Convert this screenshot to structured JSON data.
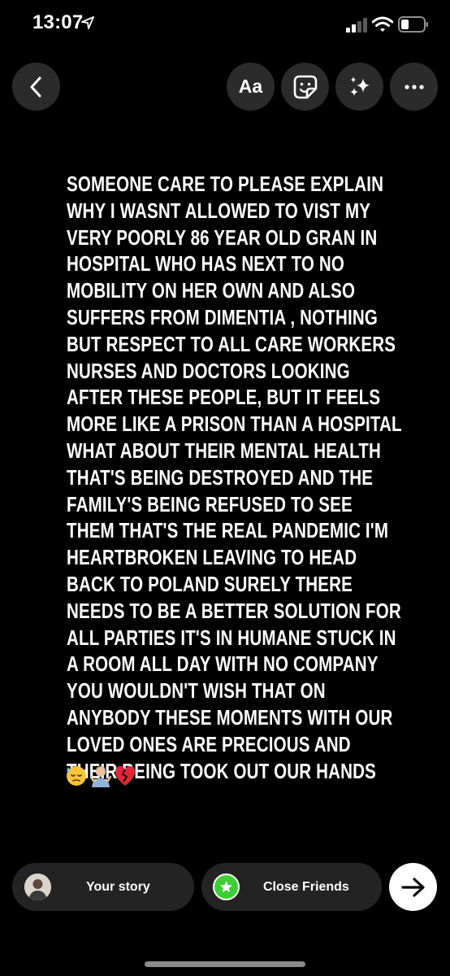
{
  "status_bar": {
    "time": "13:07",
    "icons": [
      "location-arrow-icon",
      "cellular-signal-icon",
      "wifi-icon",
      "battery-icon"
    ]
  },
  "toolbar": {
    "back_icon": "chevron-left-icon",
    "text_label": "Aa",
    "sticker_icon": "sticker-icon",
    "effects_icon": "sparkles-icon",
    "more_icon": "ellipsis-icon"
  },
  "story": {
    "lines": [
      "SOMEONE CARE TO PLEASE EXPLAIN",
      "WHY I WASNT ALLOWED TO VIST MY",
      "VERY POORLY 86 YEAR OLD GRAN IN",
      "HOSPITAL WHO HAS NEXT TO NO",
      "MOBILITY ON HER OWN AND ALSO",
      "SUFFERS FROM DIMENTIA  , NOTHING",
      "BUT RESPECT TO ALL CARE WORKERS",
      "NURSES AND DOCTORS LOOKING",
      "AFTER THESE PEOPLE, BUT IT FEELS",
      "MORE LIKE A PRISON THAN A HOSPITAL",
      "WHAT ABOUT THEIR MENTAL HEALTH",
      "THAT'S BEING DESTROYED AND THE",
      "FAMILY'S BEING REFUSED TO SEE",
      "THEM THAT'S THE REAL PANDEMIC I'M",
      "HEARTBROKEN LEAVING TO HEAD",
      "BACK TO POLAND SURELY THERE",
      "NEEDS TO BE A BETTER SOLUTION FOR",
      "ALL PARTIES IT'S IN HUMANE STUCK IN",
      "A ROOM ALL DAY WITH NO COMPANY",
      "YOU WOULDN'T WISH THAT ON",
      "ANYBODY THESE MOMENTS WITH OUR",
      "LOVED ONES ARE PRECIOUS AND",
      "THEIR BEING TOOK OUT OUR HANDS"
    ],
    "emojis": [
      "downcast-sweat-face-icon",
      "shrugging-person-icon",
      "broken-heart-icon"
    ]
  },
  "share_bar": {
    "your_story_label": "Your story",
    "close_friends_label": "Close Friends",
    "close_friends_icon": "star-icon",
    "send_icon": "arrow-right-icon"
  },
  "colors": {
    "background": "#000000",
    "button_bg": "#2b2b2b",
    "pill_bg": "#232323",
    "close_friends_green": "#3fce35",
    "text": "#ffffff"
  }
}
